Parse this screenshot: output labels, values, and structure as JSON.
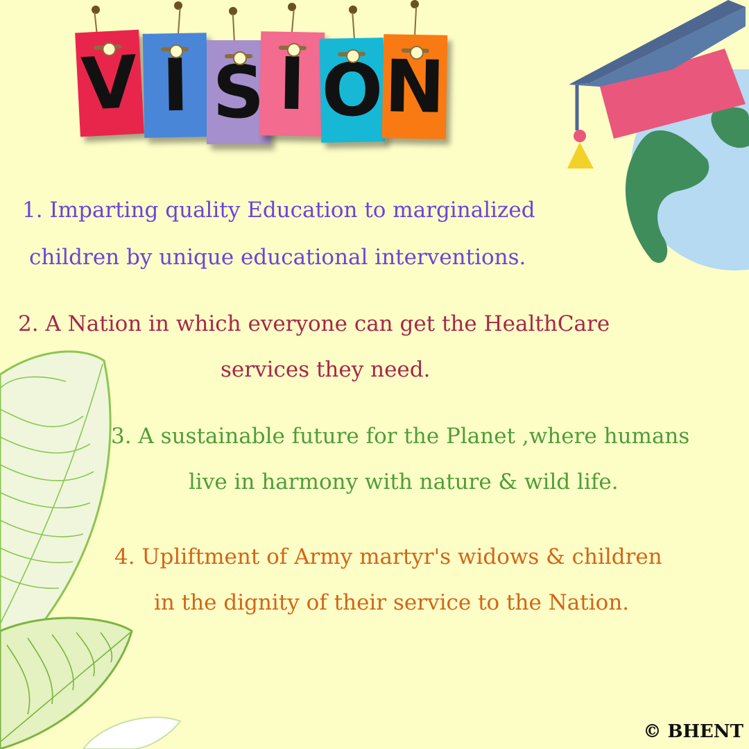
{
  "title": {
    "letters": [
      "V",
      "I",
      "S",
      "I",
      "O",
      "N"
    ],
    "tag_colors": [
      "#e8264c",
      "#4a86d8",
      "#a58fcc",
      "#f36b8e",
      "#17b8d6",
      "#f97a12"
    ]
  },
  "points": [
    {
      "line1": "1. Imparting quality Education to marginalized",
      "line2": "children by unique educational interventions."
    },
    {
      "line1": "2. A Nation in which everyone can get the HealthCare",
      "line2": "services they need."
    },
    {
      "line1": "3. A sustainable future for the Planet ,where humans",
      "line2": "live in harmony with nature & wild life."
    },
    {
      "line1": "4. Upliftment of Army martyr's widows & children",
      "line2": "in the dignity of their service to the Nation."
    }
  ],
  "copyright": "© BHENT",
  "colors": {
    "background": "#fdfdc6",
    "point1": "#6a45d9",
    "point2": "#a5284a",
    "point3": "#4f9d3a",
    "point4": "#d0661a",
    "globe_ocean": "#b5daf2",
    "globe_land": "#3f8d5b",
    "cap_board": "#4d6791",
    "cap_body": "#e9577c",
    "tassel": "#f2d229",
    "leaf": "#8cc552"
  },
  "decorations": [
    "graduation-cap-icon",
    "globe-icon",
    "leaf-decoration"
  ]
}
